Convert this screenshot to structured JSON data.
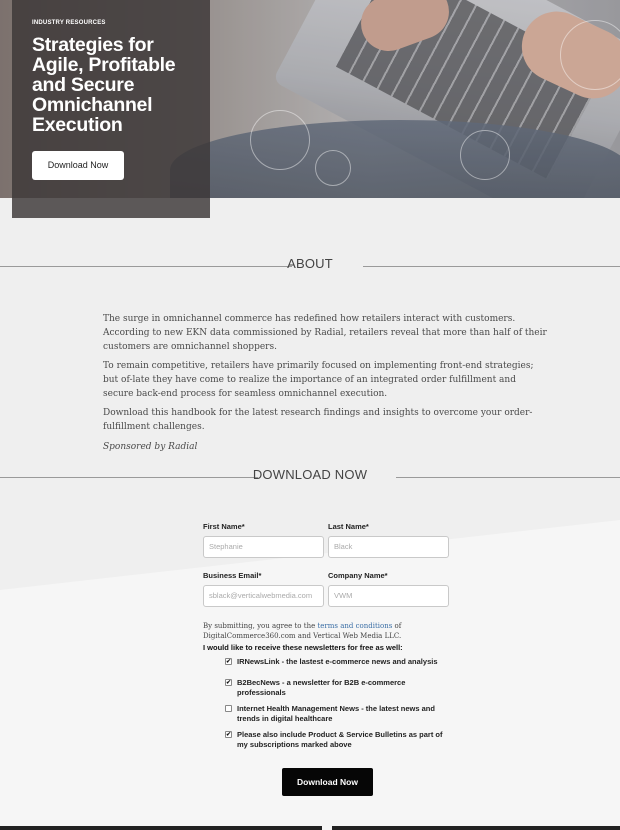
{
  "hero": {
    "eyebrow": "INDUSTRY RESOURCES",
    "title": "Strategies for Agile, Profitable and Secure Omnichannel Execution",
    "button_label": "Download Now"
  },
  "about": {
    "heading": "ABOUT",
    "paragraphs": [
      "The surge in omnichannel commerce has redefined how retailers interact with customers. According to new EKN data commissioned by Radial, retailers reveal that more than half of their customers are omnichannel shoppers.",
      "To remain competitive, retailers have primarily focused on implementing front-end strategies; but of-late they have come to realize the importance of an integrated order fulfillment and secure back-end process for seamless omnichannel execution.",
      "Download this handbook for the latest research findings and insights to overcome your order-fulfillment challenges."
    ],
    "sponsor": "Sponsored by Radial"
  },
  "download": {
    "heading": "DOWNLOAD NOW",
    "fields": {
      "first_name": {
        "label": "First Name*",
        "placeholder": "Stephanie"
      },
      "last_name": {
        "label": "Last Name*",
        "placeholder": "Black"
      },
      "email": {
        "label": "Business Email*",
        "placeholder": "sblack@verticalwebmedia.com"
      },
      "company": {
        "label": "Company Name*",
        "placeholder": "VWM"
      }
    },
    "disclaimer_pre": "By submitting, you agree to the ",
    "disclaimer_link": "terms and conditions",
    "disclaimer_post": " of DigitalCommerce360.com and Vertical Web Media LLC.",
    "newsletter_heading": "I would like to receive these newsletters for free as well:",
    "newsletters": [
      {
        "label": "IRNewsLink - the lastest e-commerce news and analysis",
        "checked": true
      },
      {
        "label": "B2BecNews - a newsletter for B2B e-commerce professionals",
        "checked": true
      },
      {
        "label": "Internet Health Management News - the latest news and trends in digital healthcare",
        "checked": false
      },
      {
        "label": "Please also include Product & Service Bulletins as part of my subscriptions marked above",
        "checked": true
      }
    ],
    "submit_label": "Download Now"
  }
}
